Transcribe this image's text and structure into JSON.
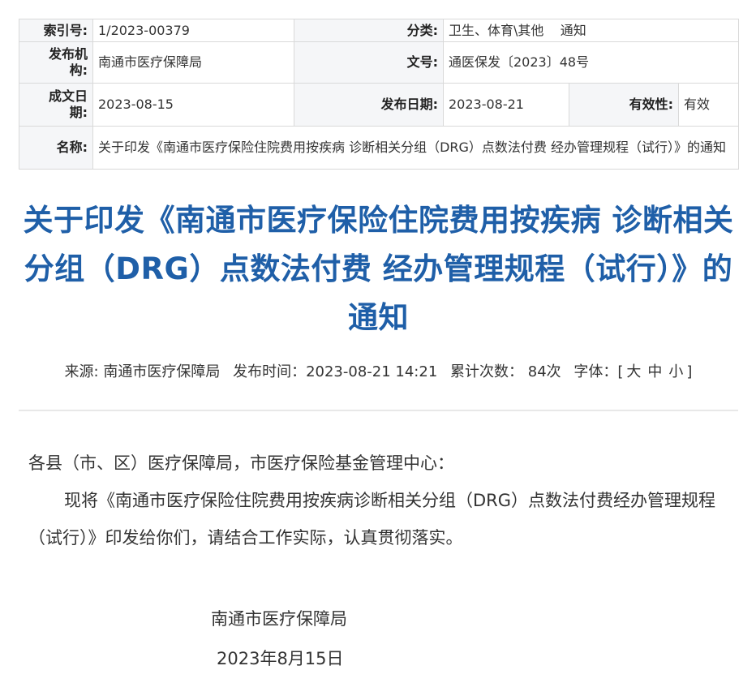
{
  "meta": {
    "index_label": "索引号:",
    "index_value": "1/2023-00379",
    "category_label": "分类:",
    "category_value": "卫生、体育\\其他    通知",
    "publisher_label": "发布机构:",
    "publisher_value": "南通市医疗保障局",
    "docno_label": "文号:",
    "docno_value": "通医保发〔2023〕48号",
    "created_label": "成文日期:",
    "created_value": "2023-08-15",
    "pubdate_label": "发布日期:",
    "pubdate_value": "2023-08-21",
    "validity_label": "有效性:",
    "validity_value": "有效",
    "name_label": "名称:",
    "name_value": "关于印发《南通市医疗保险住院费用按疾病 诊断相关分组（DRG）点数法付费 经办管理规程（试行）》的通知"
  },
  "article": {
    "title": "关于印发《南通市医疗保险住院费用按疾病 诊断相关分组（DRG）点数法付费 经办管理规程（试行）》的通知",
    "source": "来源: 南通市医疗保障局",
    "publish_time": "发布时间：2023-08-21 14:21",
    "view_count": "累计次数：  84次",
    "font_size_label": "字体：[",
    "font_large": "大",
    "font_medium": "中",
    "font_small": "小",
    "font_close": "]",
    "salutation": "各县（市、区）医疗保障局，市医疗保险基金管理中心：",
    "paragraph": "现将《南通市医疗保险住院费用按疾病诊断相关分组（DRG）点数法付费经办管理规程（试行）》印发给你们，请结合工作实际，认真贯彻落实。",
    "signature_org": "南通市医疗保障局",
    "signature_date": "2023年8月15日"
  },
  "colors": {
    "title": "#1f5fa8",
    "label_bg": "#f5f6f8",
    "border": "#d9d9d9"
  }
}
